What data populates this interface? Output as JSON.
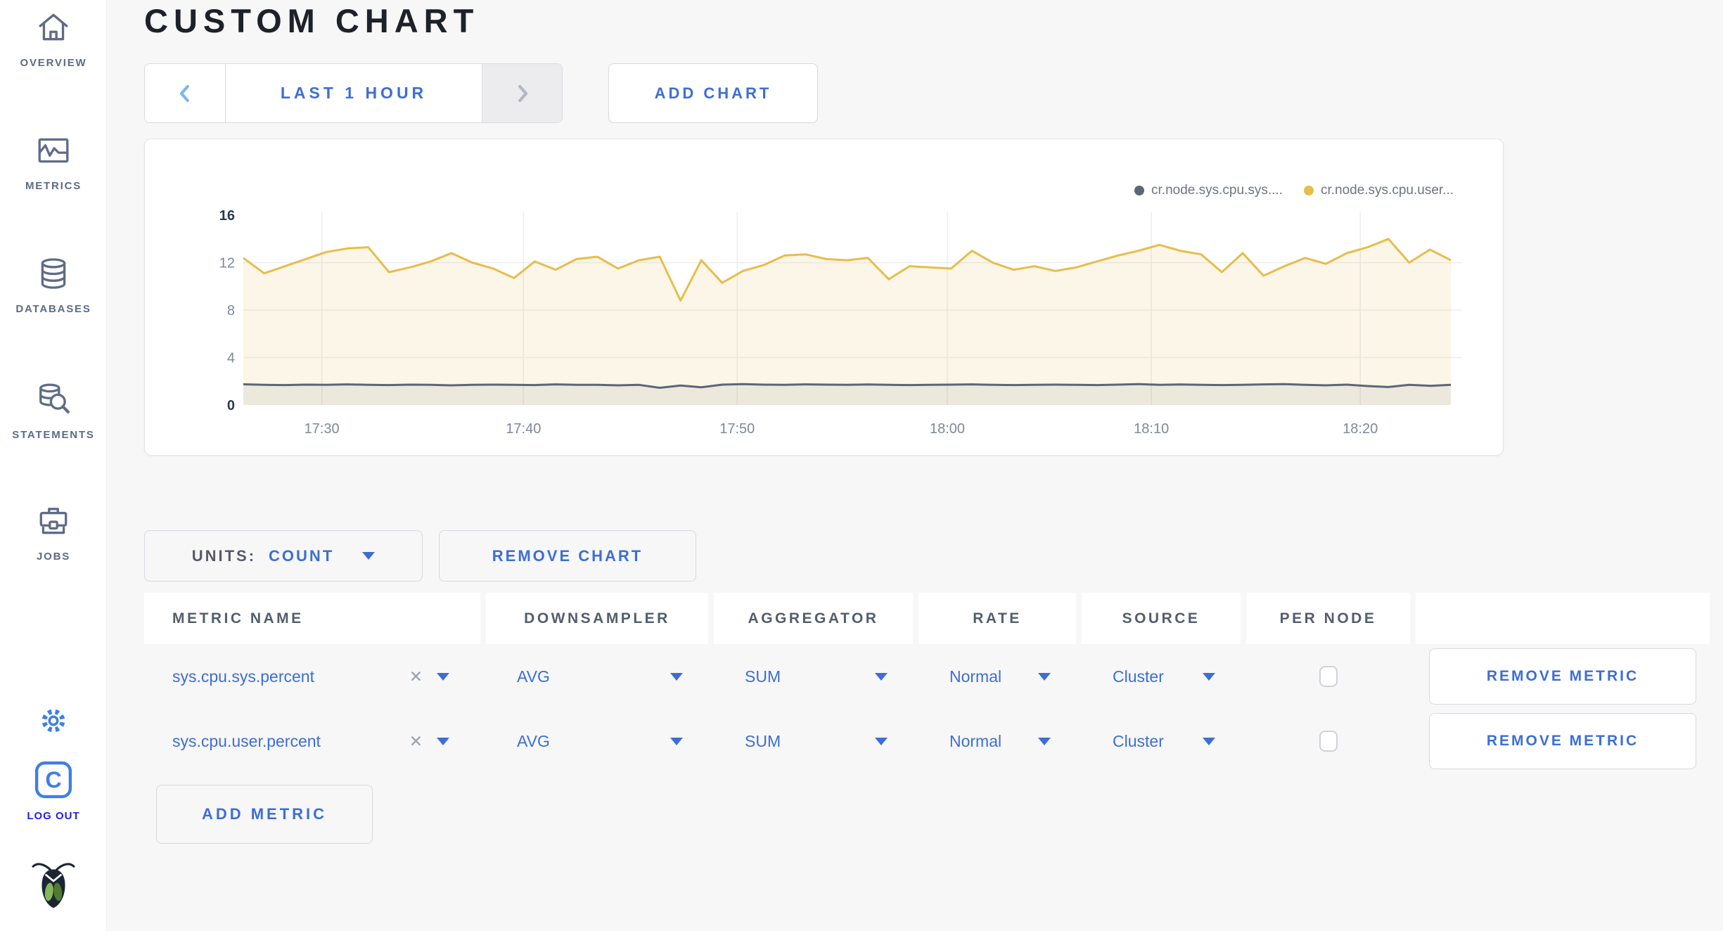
{
  "sidebar": {
    "items": [
      {
        "label": "OVERVIEW",
        "icon": "home-icon"
      },
      {
        "label": "METRICS",
        "icon": "metrics-icon"
      },
      {
        "label": "DATABASES",
        "icon": "databases-icon"
      },
      {
        "label": "STATEMENTS",
        "icon": "statements-icon"
      },
      {
        "label": "JOBS",
        "icon": "jobs-icon"
      }
    ],
    "settings_icon": "gear-icon",
    "logout": {
      "label": "LOG OUT",
      "icon_letter": "C"
    },
    "logo_icon": "cockroachdb-bug-logo"
  },
  "header": {
    "title": "CUSTOM CHART"
  },
  "toolbar": {
    "time_range_label": "LAST 1 HOUR",
    "next_disabled": true,
    "add_chart_label": "ADD CHART"
  },
  "chart_data": {
    "type": "area",
    "title": "",
    "xlabel": "",
    "ylabel": "",
    "ylim": [
      0,
      16
    ],
    "yticks": [
      0,
      4,
      8,
      12,
      16
    ],
    "xticks": [
      {
        "label": "17:30",
        "frac": 0.065
      },
      {
        "label": "17:40",
        "frac": 0.232
      },
      {
        "label": "17:50",
        "frac": 0.409
      },
      {
        "label": "18:00",
        "frac": 0.583
      },
      {
        "label": "18:10",
        "frac": 0.752
      },
      {
        "label": "18:20",
        "frac": 0.925
      }
    ],
    "grid": true,
    "legend_position": "top-right",
    "series": [
      {
        "name": "cr.node.sys.cpu.sys....",
        "color": "#5c6677",
        "fill": "rgba(100,108,122,0.10)",
        "values": [
          1.75,
          1.7,
          1.68,
          1.72,
          1.7,
          1.74,
          1.7,
          1.68,
          1.72,
          1.7,
          1.66,
          1.7,
          1.72,
          1.7,
          1.68,
          1.74,
          1.7,
          1.7,
          1.66,
          1.7,
          1.45,
          1.65,
          1.5,
          1.72,
          1.76,
          1.72,
          1.7,
          1.74,
          1.72,
          1.7,
          1.73,
          1.7,
          1.68,
          1.7,
          1.72,
          1.74,
          1.7,
          1.68,
          1.7,
          1.72,
          1.7,
          1.68,
          1.72,
          1.76,
          1.7,
          1.73,
          1.7,
          1.68,
          1.7,
          1.74,
          1.76,
          1.7,
          1.66,
          1.72,
          1.6,
          1.52,
          1.7,
          1.62,
          1.7
        ]
      },
      {
        "name": "cr.node.sys.cpu.user...",
        "color": "#e7bd4b",
        "fill": "rgba(231,189,75,0.13)",
        "values": [
          12.4,
          11.1,
          11.7,
          12.3,
          12.9,
          13.2,
          13.3,
          11.2,
          11.6,
          12.1,
          12.8,
          12.0,
          11.5,
          10.7,
          12.1,
          11.4,
          12.3,
          12.5,
          11.5,
          12.2,
          12.5,
          8.8,
          12.2,
          10.3,
          11.3,
          11.8,
          12.6,
          12.7,
          12.3,
          12.2,
          12.4,
          10.6,
          11.7,
          11.6,
          11.5,
          13.0,
          12.0,
          11.4,
          11.7,
          11.3,
          11.6,
          12.1,
          12.6,
          13.0,
          13.5,
          13.0,
          12.7,
          11.2,
          12.8,
          10.9,
          11.7,
          12.4,
          11.9,
          12.8,
          13.3,
          14.0,
          12.0,
          13.1,
          12.2
        ]
      }
    ]
  },
  "units_row": {
    "units_label": "UNITS:",
    "units_value": "COUNT",
    "remove_chart_label": "REMOVE CHART"
  },
  "metrics_table": {
    "columns": [
      "METRIC NAME",
      "DOWNSAMPLER",
      "AGGREGATOR",
      "RATE",
      "SOURCE",
      "PER NODE",
      ""
    ],
    "clear_icon": "✕",
    "rows": [
      {
        "metric_name": "sys.cpu.sys.percent",
        "downsampler": "AVG",
        "aggregator": "SUM",
        "rate": "Normal",
        "source": "Cluster",
        "per_node_checked": false,
        "remove_label": "REMOVE METRIC"
      },
      {
        "metric_name": "sys.cpu.user.percent",
        "downsampler": "AVG",
        "aggregator": "SUM",
        "rate": "Normal",
        "source": "Cluster",
        "per_node_checked": false,
        "remove_label": "REMOVE METRIC"
      }
    ]
  },
  "footer": {
    "add_metric_label": "ADD METRIC"
  },
  "colors": {
    "accent_blue": "#3d6ed5",
    "light_blue": "#79b7f2",
    "slate": "#5f6c87",
    "axis_dark": "#2c3a52",
    "axis_gray": "#7e8899",
    "series_sys": "#5c6677",
    "series_user": "#e7bd4b",
    "icon_blue": "#3f7ee8",
    "logout_text_blue": "#2020ef"
  }
}
